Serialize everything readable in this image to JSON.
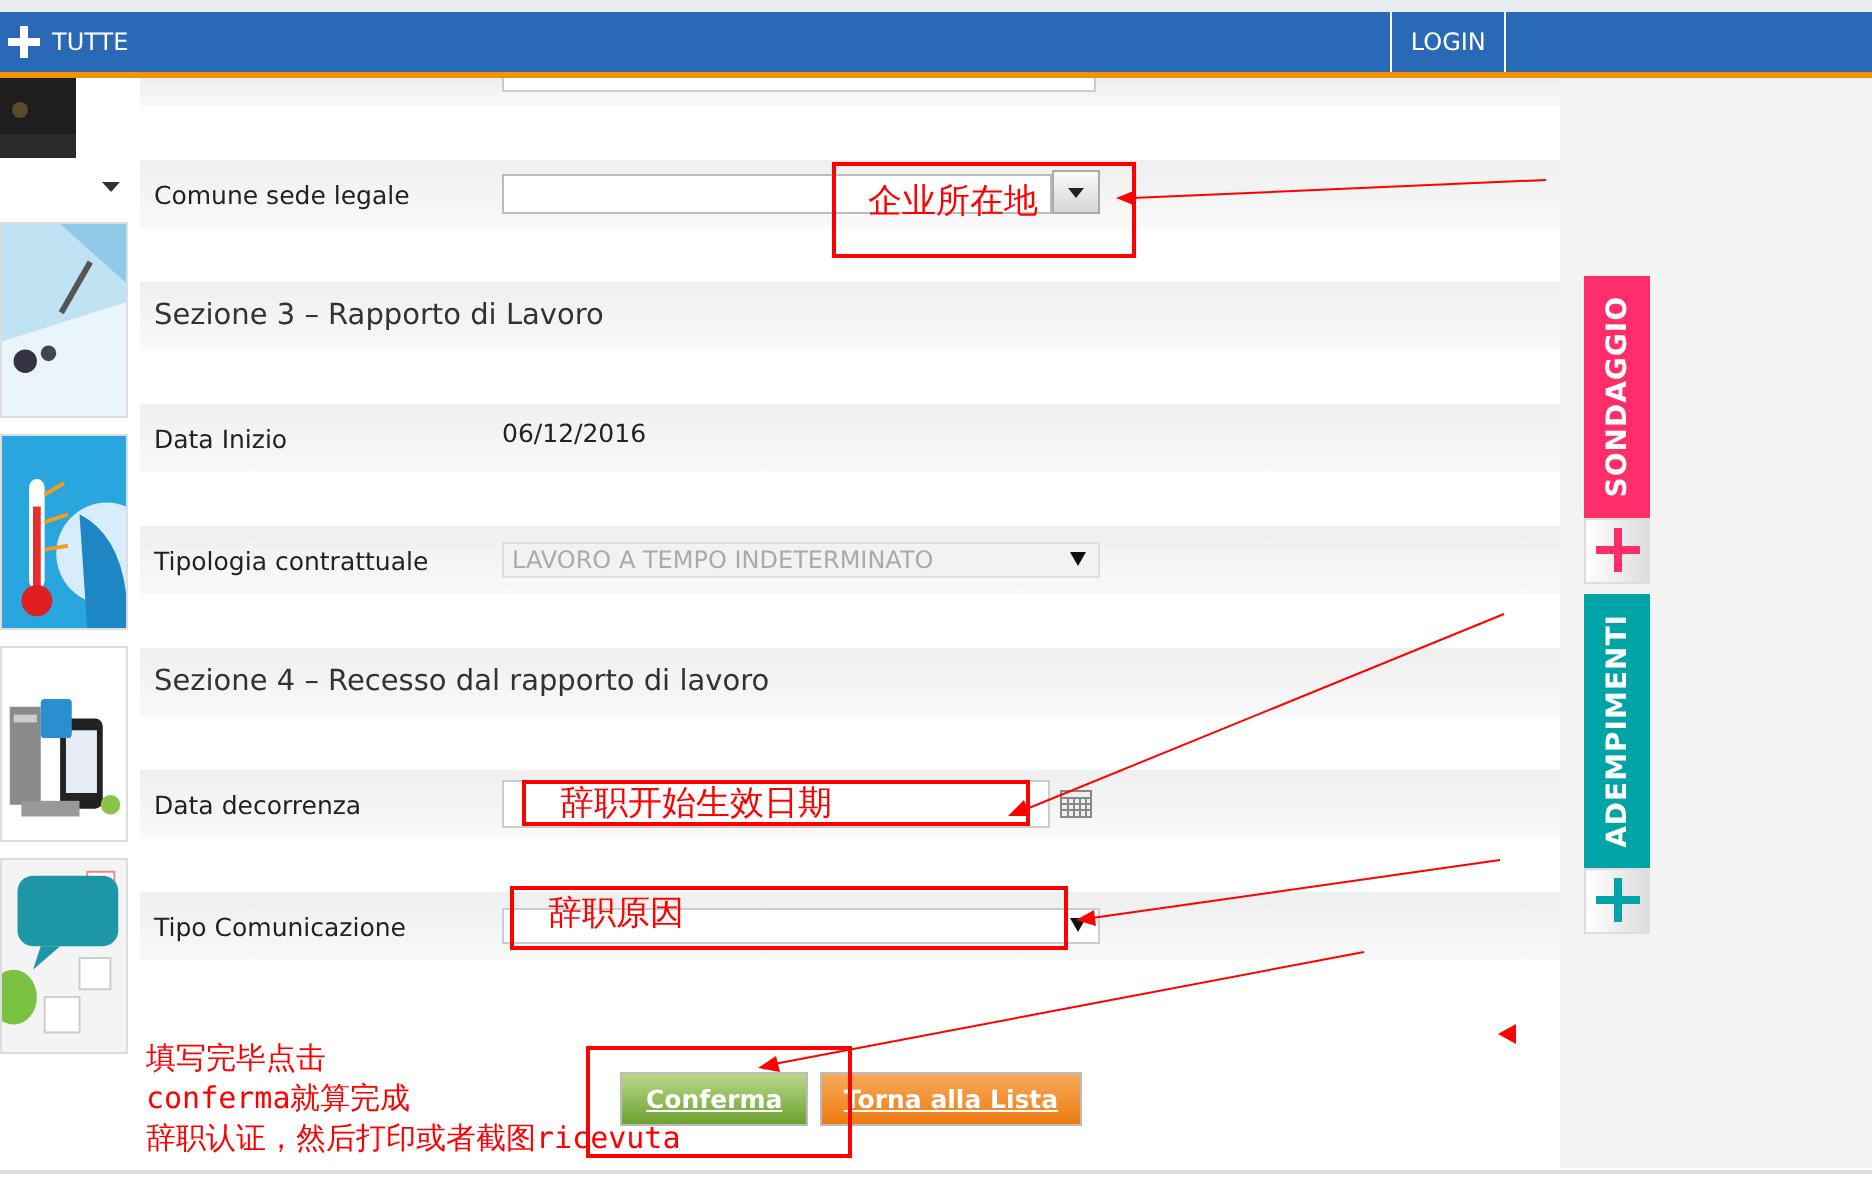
{
  "top_bar": {
    "menu_label": "TUTTE",
    "login": "LOGIN"
  },
  "form": {
    "rows": [
      {
        "kind": "field",
        "control": {
          "kind": "text"
        }
      },
      {
        "kind": "field",
        "label": "Comune sede legale",
        "control": {
          "kind": "combo"
        }
      },
      {
        "kind": "section",
        "title": "Sezione 3 – Rapporto di Lavoro"
      },
      {
        "kind": "field",
        "label": "Data Inizio",
        "control": {
          "kind": "static"
        },
        "value": "06/12/2016"
      },
      {
        "kind": "field",
        "label": "Tipologia contrattuale",
        "control": {
          "kind": "select"
        },
        "value": "LAVORO A TEMPO INDETERMINATO",
        "disabled": true
      },
      {
        "kind": "section",
        "title": "Sezione 4 – Recesso dal rapporto di lavoro"
      },
      {
        "kind": "field",
        "label": "Data decorrenza",
        "control": {
          "kind": "date"
        }
      },
      {
        "kind": "field",
        "label": "Tipo Comunicazione",
        "control": {
          "kind": "select"
        },
        "disabled": false
      }
    ],
    "buttons": [
      {
        "label": "Conferma",
        "kind": "confirm"
      },
      {
        "label": "Torna alla Lista",
        "kind": "back"
      }
    ]
  },
  "side_tabs": [
    {
      "label": "SONDAGGIO",
      "color": "#ff2d6a"
    },
    {
      "label": "ADEMPIMENTI",
      "color": "#00a3a6"
    }
  ],
  "annotations": {
    "labels": [
      "企业所在地",
      "辞职开始生效日期",
      "辞职原因"
    ],
    "note_lines": [
      "填写完毕点击",
      "conferma就算完成",
      "辞职认证，然后打印或者截图ricevuta"
    ]
  }
}
